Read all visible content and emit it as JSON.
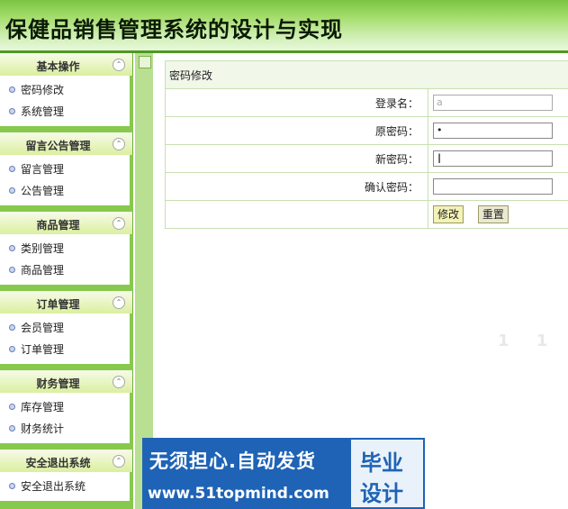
{
  "app": {
    "title": "保健品销售管理系统的设计与实现"
  },
  "sidebar": {
    "groups": [
      {
        "title": "基本操作",
        "items": [
          "密码修改",
          "系统管理"
        ]
      },
      {
        "title": "留言公告管理",
        "items": [
          "留言管理",
          "公告管理"
        ]
      },
      {
        "title": "商品管理",
        "items": [
          "类别管理",
          "商品管理"
        ]
      },
      {
        "title": "订单管理",
        "items": [
          "会员管理",
          "订单管理"
        ]
      },
      {
        "title": "财务管理",
        "items": [
          "库存管理",
          "财务统计"
        ]
      },
      {
        "title": "安全退出系统",
        "items": [
          "安全退出系统"
        ]
      }
    ],
    "toggle_glyph": "⌃"
  },
  "form": {
    "heading": "密码修改",
    "fields": [
      {
        "label": "登录名：",
        "value": "a"
      },
      {
        "label": "原密码：",
        "value": "•"
      },
      {
        "label": "新密码：",
        "value": ""
      },
      {
        "label": "确认密码：",
        "value": ""
      }
    ],
    "submit_label": "修改",
    "reset_label": "重置"
  },
  "watermark": {
    "line1": "无须担心.自动发货",
    "line2": "www.51topmind.com",
    "badge1": "毕业",
    "badge2": "设计"
  },
  "cursor_glyph": "I",
  "ghost_text": "1 1"
}
